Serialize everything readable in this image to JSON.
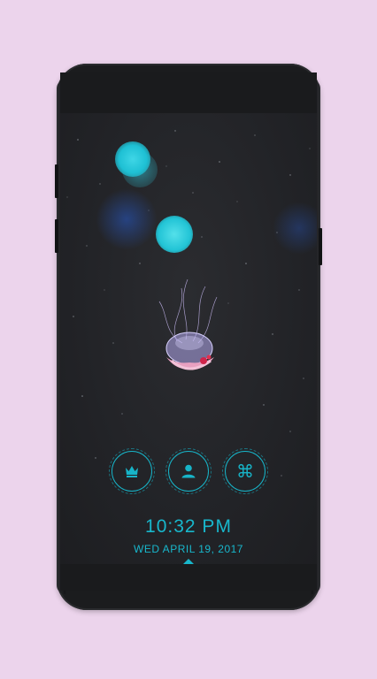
{
  "lockscreen": {
    "time": "10:32 PM",
    "date": "WED APRIL 19, 2017"
  },
  "shortcuts": [
    {
      "icon": "crown-icon"
    },
    {
      "icon": "person-icon"
    },
    {
      "icon": "command-icon"
    }
  ],
  "colors": {
    "background": "#ecd4ec",
    "accent": "#18b7cc",
    "phone_body": "#1b1c1e"
  }
}
